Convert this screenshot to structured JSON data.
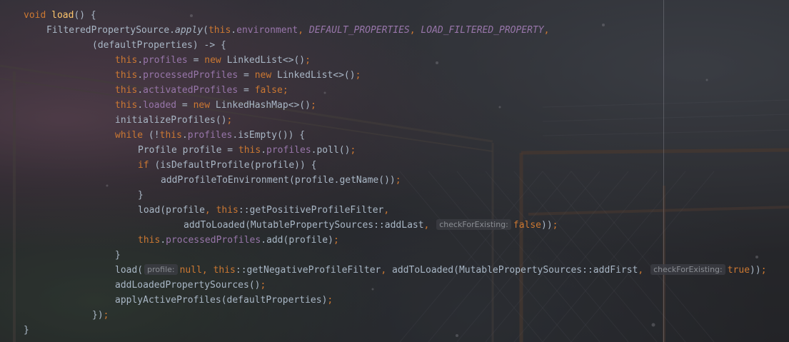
{
  "editor": {
    "colors": {
      "keyword": "#cc7832",
      "text": "#a9b7c6",
      "field": "#9876aa",
      "method_decl": "#ffc66d",
      "hint": "#8a8d93"
    },
    "lines": [
      [
        [
          "k",
          "void "
        ],
        [
          "m",
          "load"
        ],
        [
          "t",
          "() {"
        ]
      ],
      [
        [
          "t",
          "FilteredPropertySource."
        ],
        [
          "si",
          "apply"
        ],
        [
          "t",
          "("
        ],
        [
          "k",
          "this"
        ],
        [
          "t",
          "."
        ],
        [
          "f",
          "environment"
        ],
        [
          "k",
          ", "
        ],
        [
          "sf",
          "DEFAULT_PROPERTIES"
        ],
        [
          "k",
          ", "
        ],
        [
          "sf",
          "LOAD_FILTERED_PROPERTY"
        ],
        [
          "k",
          ","
        ]
      ],
      [
        [
          "t",
          "(defaultProperties) -> {"
        ]
      ],
      [
        [
          "k",
          "this"
        ],
        [
          "t",
          "."
        ],
        [
          "f",
          "profiles"
        ],
        [
          "t",
          " = "
        ],
        [
          "k",
          "new "
        ],
        [
          "t",
          "LinkedList<>()"
        ],
        [
          "k",
          ";"
        ]
      ],
      [
        [
          "k",
          "this"
        ],
        [
          "t",
          "."
        ],
        [
          "f",
          "processedProfiles"
        ],
        [
          "t",
          " = "
        ],
        [
          "k",
          "new "
        ],
        [
          "t",
          "LinkedList<>()"
        ],
        [
          "k",
          ";"
        ]
      ],
      [
        [
          "k",
          "this"
        ],
        [
          "t",
          "."
        ],
        [
          "f",
          "activatedProfiles"
        ],
        [
          "t",
          " = "
        ],
        [
          "k",
          "false"
        ],
        [
          "k",
          ";"
        ]
      ],
      [
        [
          "k",
          "this"
        ],
        [
          "t",
          "."
        ],
        [
          "f",
          "loaded"
        ],
        [
          "t",
          " = "
        ],
        [
          "k",
          "new "
        ],
        [
          "t",
          "LinkedHashMap<>()"
        ],
        [
          "k",
          ";"
        ]
      ],
      [
        [
          "t",
          "initializeProfiles()"
        ],
        [
          "k",
          ";"
        ]
      ],
      [
        [
          "k",
          "while "
        ],
        [
          "t",
          "(!"
        ],
        [
          "k",
          "this"
        ],
        [
          "t",
          "."
        ],
        [
          "f",
          "profiles"
        ],
        [
          "t",
          ".isEmpty()) {"
        ]
      ],
      [
        [
          "t",
          "Profile profile = "
        ],
        [
          "k",
          "this"
        ],
        [
          "t",
          "."
        ],
        [
          "f",
          "profiles"
        ],
        [
          "t",
          ".poll()"
        ],
        [
          "k",
          ";"
        ]
      ],
      [
        [
          "k",
          "if "
        ],
        [
          "t",
          "(isDefaultProfile(profile)) {"
        ]
      ],
      [
        [
          "t",
          "addProfileToEnvironment(profile.getName())"
        ],
        [
          "k",
          ";"
        ]
      ],
      [
        [
          "t",
          "}"
        ]
      ],
      [
        [
          "t",
          "load(profile"
        ],
        [
          "k",
          ", "
        ],
        [
          "k",
          "this"
        ],
        [
          "t",
          "::getPositiveProfileFilter"
        ],
        [
          "k",
          ","
        ]
      ],
      [
        [
          "t",
          "addToLoaded(MutablePropertySources::addLast"
        ],
        [
          "k",
          ", "
        ],
        [
          "hint",
          "checkForExisting:"
        ],
        [
          "k",
          "false"
        ],
        [
          "t",
          "))"
        ],
        [
          "k",
          ";"
        ]
      ],
      [
        [
          "k",
          "this"
        ],
        [
          "t",
          "."
        ],
        [
          "f",
          "processedProfiles"
        ],
        [
          "t",
          ".add(profile)"
        ],
        [
          "k",
          ";"
        ]
      ],
      [
        [
          "t",
          "}"
        ]
      ],
      [
        [
          "t",
          "load("
        ],
        [
          "hint",
          "profile:"
        ],
        [
          "k",
          "null"
        ],
        [
          "k",
          ", "
        ],
        [
          "k",
          "this"
        ],
        [
          "t",
          "::getNegativeProfileFilter"
        ],
        [
          "k",
          ", "
        ],
        [
          "t",
          "addToLoaded(MutablePropertySources::addFirst"
        ],
        [
          "k",
          ", "
        ],
        [
          "hint",
          "checkForExisting:"
        ],
        [
          "k",
          "true"
        ],
        [
          "t",
          "))"
        ],
        [
          "k",
          ";"
        ]
      ],
      [
        [
          "t",
          "addLoadedPropertySources()"
        ],
        [
          "k",
          ";"
        ]
      ],
      [
        [
          "t",
          "applyActiveProfiles(defaultProperties)"
        ],
        [
          "k",
          ";"
        ]
      ],
      [
        [
          "t",
          "})"
        ],
        [
          "k",
          ";"
        ]
      ],
      [
        [
          "t",
          "}"
        ]
      ]
    ]
  }
}
